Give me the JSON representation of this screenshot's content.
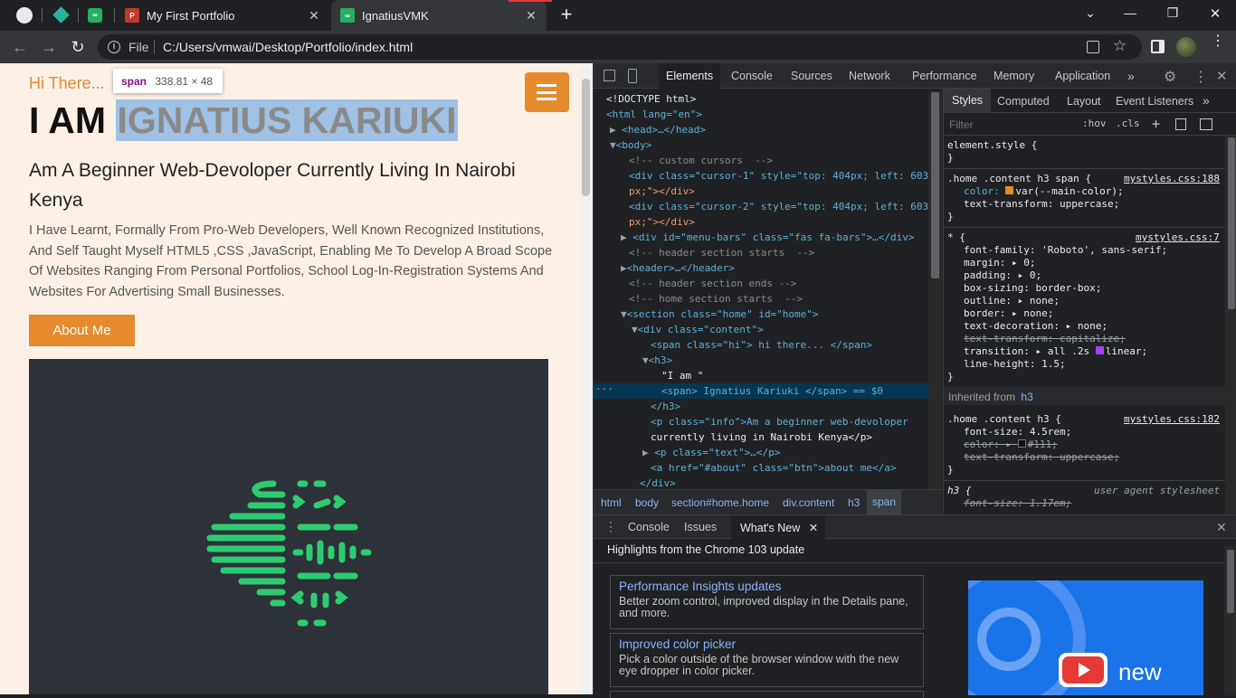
{
  "browser": {
    "tabs": [
      {
        "title": "",
        "icon": "github-icon"
      },
      {
        "title": "",
        "icon": "diamond-icon"
      },
      {
        "title": "",
        "icon": "nd-icon"
      },
      {
        "title": "My First Portfolio",
        "icon": "portfolio-icon",
        "close": "✕"
      },
      {
        "title": "IgnatiusVMK",
        "icon": "nd-icon",
        "close": "✕"
      }
    ],
    "new_tab": "+",
    "address_prefix": "File",
    "address": "C:/Users/vmwai/Desktop/Portfolio/index.html",
    "window_controls": [
      "⌄",
      "—",
      "❐",
      "✕"
    ]
  },
  "page": {
    "greeting": "Hi There...",
    "heading_prefix": "I AM",
    "heading_name": "IGNATIUS KARIUKI",
    "tagline": "Am A Beginner Web-Devoloper Currently Living In Nairobi Kenya",
    "description": "I Have Learnt, Formally From Pro-Web Developers, Well Known Recognized Institutions, And Self Taught Myself HTML5 ,CSS ,JavaScript, Enabling Me To Develop A Broad Scope Of Websites Ranging From Personal Portfolios, School Log-In-Registration Systems And Websites For Advertising Small Businesses.",
    "about_button": "About Me",
    "tooltip_tag": "span",
    "tooltip_size": "338.81 × 48"
  },
  "devtools": {
    "tabs": [
      "Elements",
      "Console",
      "Sources",
      "Network",
      "Performance",
      "Memory",
      "Application"
    ],
    "more": "»",
    "elements_lines": [
      "<!DOCTYPE html>",
      "<html lang=\"en\">",
      "<head>…</head>",
      "<body>",
      "<!-- custom cursors  -->",
      "<div class=\"cursor-1\" style=\"top: 404px; left: 603",
      "px;\"></div>",
      "<div class=\"cursor-2\" style=\"top: 404px; left: 603",
      "px;\"></div>",
      "<div id=\"menu-bars\" class=\"fas fa-bars\">…</div>",
      "<!-- header section starts  -->",
      "<header>…</header>",
      "<!-- header section ends -->",
      "<!-- home section starts  -->",
      "<section class=\"home\" id=\"home\">",
      "<div class=\"content\">",
      "<span class=\"hi\"> hi there... </span>",
      "<h3>",
      "\"I am \"",
      "<span> Ignatius Kariuki </span> == $0",
      "</h3>",
      "<p class=\"info\">Am a beginner web-devoloper",
      "currently living in Nairobi Kenya</p>",
      "<p class=\"text\">…</p>",
      "<a href=\"#about\" class=\"btn\">about me</a>",
      "</div>"
    ],
    "breadcrumbs": [
      "html",
      "body",
      "section#home.home",
      "div.content",
      "h3",
      "span"
    ],
    "styles_tabs": [
      "Styles",
      "Computed",
      "Layout",
      "Event Listeners"
    ],
    "filter_placeholder": "Filter",
    "filter_tools": [
      ":hov",
      ".cls",
      "+"
    ],
    "styles": {
      "element_style": "element.style {",
      "rule1_selector": ".home .content h3 span {",
      "rule1_source": "mystyles.css:188",
      "rule1_props": [
        "color: ",
        "var(--main-color);",
        "text-transform: uppercase;"
      ],
      "rule2_selector": "* {",
      "rule2_source": "mystyles.css:7",
      "rule2_props": [
        "font-family: 'Roboto', sans-serif;",
        "margin: ▸ 0;",
        "padding: ▸ 0;",
        "box-sizing: border-box;",
        "outline: ▸ none;",
        "border: ▸ none;",
        "text-decoration: ▸ none;",
        "text-transform: capitalize;",
        "transition: ▸ all .2s ",
        "linear;",
        "line-height: 1.5;"
      ],
      "inherited_label": "Inherited from",
      "inherited_tag": "h3",
      "rule3_selector": ".home .content h3 {",
      "rule3_source": "mystyles.css:182",
      "rule3_props": [
        "font-size: 4.5rem;",
        "color: ▸ ",
        "#111;",
        "text-transform: uppercase;"
      ],
      "rule4_selector": "h3 {",
      "rule4_source": "user agent stylesheet",
      "rule4_props": [
        "font-size: 1.17em;"
      ],
      "closing": "}"
    },
    "drawer": {
      "tabs": [
        "Console",
        "Issues",
        "What's New"
      ],
      "highlights": "Highlights from the Chrome 103 update",
      "cards": [
        {
          "title": "Performance Insights updates",
          "body": "Better zoom control, improved display in the Details pane, and more."
        },
        {
          "title": "Improved color picker",
          "body": "Pick a color outside of the browser window with the new eye dropper in color picker."
        }
      ],
      "video_label": "new"
    }
  },
  "colors": {
    "accent_orange": "#e68a2e",
    "page_bg": "#fdf1e7",
    "devtools_bg": "#202124",
    "logo_green": "#2ecc71"
  }
}
